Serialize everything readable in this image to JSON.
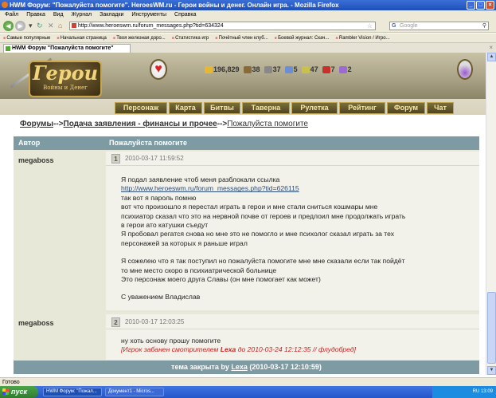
{
  "window": {
    "title": "HWM Форум: \"Пожалуйста помогите\". HeroesWM.ru - Герои войны и денег. Онлайн игра. - Mozilla Firefox",
    "min": "_",
    "max": "□",
    "close": "×"
  },
  "menu": [
    "Файл",
    "Правка",
    "Вид",
    "Журнал",
    "Закладки",
    "Инструменты",
    "Справка"
  ],
  "nav": {
    "url": "http://www.heroeswm.ru/forum_messages.php?tid=634324",
    "search_placeholder": "Google"
  },
  "bookmarks": [
    "Самые популярные",
    "Начальная страница",
    "Твоя железная доро...",
    "Статистика игр",
    "Почётный член клуб...",
    "Боевой журнал: Скач...",
    "Rambler Vision / Игро..."
  ],
  "tab": {
    "label": "HWM Форум \"Пожалуйста помогите\""
  },
  "game": {
    "logo_big": "Герои",
    "logo_small": "Войны и Денег",
    "resources": [
      {
        "value": "196,829",
        "color": "#e5b834"
      },
      {
        "value": "38",
        "color": "#8a6a3a"
      },
      {
        "value": "37",
        "color": "#888888"
      },
      {
        "value": "5",
        "color": "#6b8fd6"
      },
      {
        "value": "47",
        "color": "#c9c24a"
      },
      {
        "value": "7",
        "color": "#c9302c"
      },
      {
        "value": "2",
        "color": "#9b6bd3"
      }
    ],
    "menu": [
      "Персонаж",
      "Карта",
      "Битвы",
      "Таверна",
      "Рулетка",
      "Рейтинг",
      "Форум",
      "Чат"
    ]
  },
  "breadcrumb": {
    "forums": "Форумы",
    "sep1": "-->",
    "section": "Подача заявления - финансы и прочее",
    "sep2": "-->",
    "topic": "Пожалуйста помогите"
  },
  "forum": {
    "col_author": "Автор",
    "col_topic": "Пожалуйста помогите",
    "posts": [
      {
        "author": "megaboss",
        "num": "1",
        "date": "2010-03-17 11:59:52",
        "lines": [
          "Я подал заявление чтоб меня разблокали ссылка",
          "http://www.heroeswm.ru/forum_messages.php?tid=626115",
          "так вот я пароль помню",
          "вот что произошло я перестал играть в герои и мне стали сниться кошмары мне",
          "психиатор сказал что это на нервной почве от героев и предлоил мне продолжать играть",
          "в герои ато катушки съедут",
          "Я пробовал регатся снова но мне это не помогло и мне психолог сказал играть за тех",
          "персонажей за которых я раньше играл",
          "",
          "Я сожелею что я так поступил но пожалуйста помогите мне мне сказали если так пойдёт",
          "то мне место скоро в психиатрической больнице",
          "Это персонаж моего друга Славы (он мне помогает как может)",
          "",
          "С уважением Владислав"
        ]
      },
      {
        "author": "megaboss",
        "num": "2",
        "date": "2010-03-17 12:03:25",
        "line": "ну хоть основу прошу помогите",
        "ban_prefix": "[Игрок забанен смотрителем ",
        "ban_mod": "Lexa",
        "ban_suffix": " до 2010-03-24 12:12:35 // флудобред]"
      }
    ],
    "footer_prefix": "тема закрыта by ",
    "footer_user": "Lexa",
    "footer_suffix": " (2010-03-17 12:10:59)"
  },
  "status": "Готово",
  "taskbar": {
    "start": "пуск",
    "tasks": [
      "HWM Форум: \"Пожал...",
      "Документ1 - Micros..."
    ],
    "tray": "RU  13:09"
  }
}
